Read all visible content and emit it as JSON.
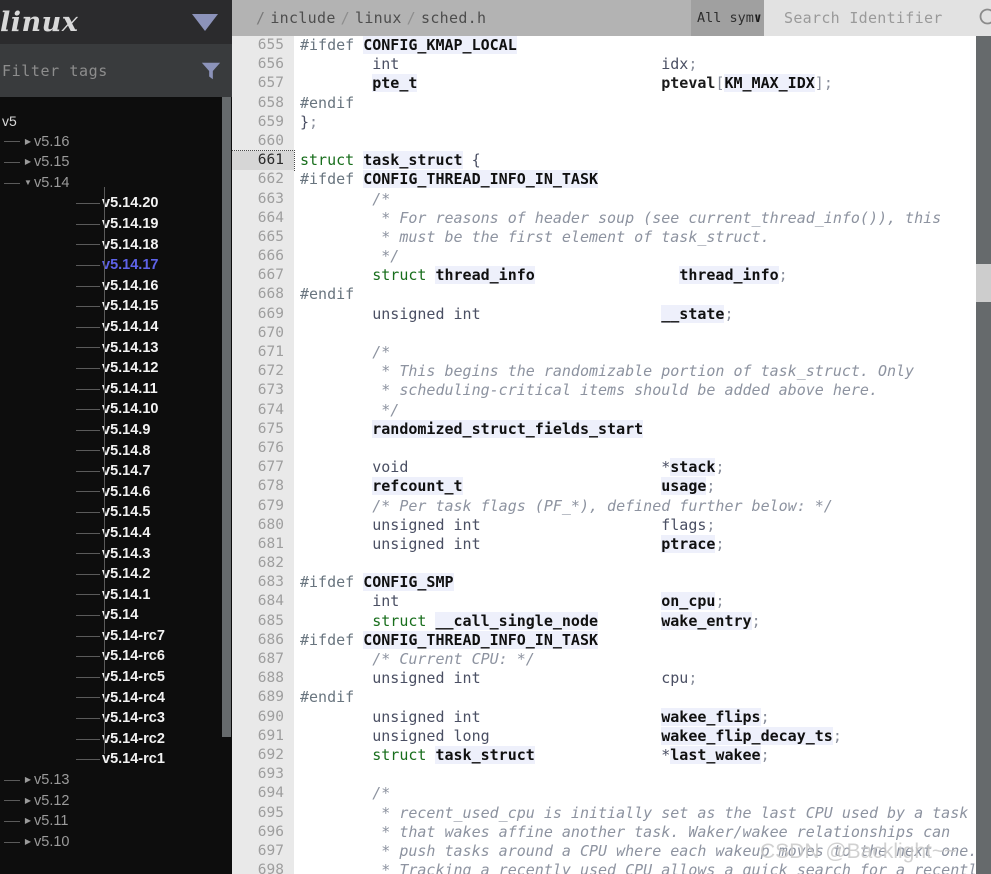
{
  "sidebar": {
    "project_title": "linux",
    "project_dropdown_icon": "chevron-down-icon",
    "filter": {
      "placeholder": "Filter tags",
      "value": "",
      "icon": "funnel-icon"
    },
    "active_tag": "v5.14.17",
    "tree": [
      {
        "label": "v5",
        "level": 0,
        "caret": ""
      },
      {
        "label": "v5.16",
        "level": 1,
        "caret": "▶"
      },
      {
        "label": "v5.15",
        "level": 1,
        "caret": "▶"
      },
      {
        "label": "v5.14",
        "level": 1,
        "caret": "▼"
      },
      {
        "label": "v5.14.20",
        "level": 2,
        "caret": ""
      },
      {
        "label": "v5.14.19",
        "level": 2,
        "caret": ""
      },
      {
        "label": "v5.14.18",
        "level": 2,
        "caret": ""
      },
      {
        "label": "v5.14.17",
        "level": 2,
        "caret": "",
        "active": true
      },
      {
        "label": "v5.14.16",
        "level": 2,
        "caret": ""
      },
      {
        "label": "v5.14.15",
        "level": 2,
        "caret": ""
      },
      {
        "label": "v5.14.14",
        "level": 2,
        "caret": ""
      },
      {
        "label": "v5.14.13",
        "level": 2,
        "caret": ""
      },
      {
        "label": "v5.14.12",
        "level": 2,
        "caret": ""
      },
      {
        "label": "v5.14.11",
        "level": 2,
        "caret": ""
      },
      {
        "label": "v5.14.10",
        "level": 2,
        "caret": ""
      },
      {
        "label": "v5.14.9",
        "level": 2,
        "caret": ""
      },
      {
        "label": "v5.14.8",
        "level": 2,
        "caret": ""
      },
      {
        "label": "v5.14.7",
        "level": 2,
        "caret": ""
      },
      {
        "label": "v5.14.6",
        "level": 2,
        "caret": ""
      },
      {
        "label": "v5.14.5",
        "level": 2,
        "caret": ""
      },
      {
        "label": "v5.14.4",
        "level": 2,
        "caret": ""
      },
      {
        "label": "v5.14.3",
        "level": 2,
        "caret": ""
      },
      {
        "label": "v5.14.2",
        "level": 2,
        "caret": ""
      },
      {
        "label": "v5.14.1",
        "level": 2,
        "caret": ""
      },
      {
        "label": "v5.14",
        "level": 2,
        "caret": ""
      },
      {
        "label": "v5.14-rc7",
        "level": 2,
        "caret": ""
      },
      {
        "label": "v5.14-rc6",
        "level": 2,
        "caret": ""
      },
      {
        "label": "v5.14-rc5",
        "level": 2,
        "caret": ""
      },
      {
        "label": "v5.14-rc4",
        "level": 2,
        "caret": ""
      },
      {
        "label": "v5.14-rc3",
        "level": 2,
        "caret": ""
      },
      {
        "label": "v5.14-rc2",
        "level": 2,
        "caret": ""
      },
      {
        "label": "v5.14-rc1",
        "level": 2,
        "caret": ""
      },
      {
        "label": "v5.13",
        "level": 1,
        "caret": "▶"
      },
      {
        "label": "v5.12",
        "level": 1,
        "caret": "▶"
      },
      {
        "label": "v5.11",
        "level": 1,
        "caret": "▶"
      },
      {
        "label": "v5.10",
        "level": 1,
        "caret": "▶"
      }
    ]
  },
  "topbar": {
    "breadcrumb": [
      "include",
      "linux",
      "sched.h"
    ],
    "breadcrumb_root": "/",
    "breadcrumb_separator": "/",
    "symbol_filter": {
      "label": "All sym",
      "icon": "chevron-down-icon"
    },
    "search": {
      "placeholder": "Search Identifier",
      "value": "",
      "icon": "search-icon"
    }
  },
  "editor": {
    "first_line": 655,
    "current_line": 661,
    "lines": [
      {
        "n": 655,
        "tokens": [
          {
            "t": "#ifdef ",
            "c": "t-pp"
          },
          {
            "t": "CONFIG_KMAP_LOCAL",
            "c": "t-macro"
          }
        ]
      },
      {
        "n": 656,
        "tokens": [
          {
            "t": "        int",
            "c": "t-plain"
          },
          {
            "t": "                             ",
            "c": "t-plain"
          },
          {
            "t": "idx",
            "c": "t-plain"
          },
          {
            "t": ";",
            "c": "t-punc"
          }
        ]
      },
      {
        "n": 657,
        "tokens": [
          {
            "t": "        ",
            "c": "t-plain"
          },
          {
            "t": "pte_t",
            "c": "t-id"
          },
          {
            "t": "                           ",
            "c": "t-plain"
          },
          {
            "t": "pteval",
            "c": "t-idp"
          },
          {
            "t": "[",
            "c": "t-punc"
          },
          {
            "t": "KM_MAX_IDX",
            "c": "t-macro"
          },
          {
            "t": "]",
            "c": "t-punc"
          },
          {
            "t": ";",
            "c": "t-punc"
          }
        ]
      },
      {
        "n": 658,
        "tokens": [
          {
            "t": "#endif",
            "c": "t-pp"
          }
        ]
      },
      {
        "n": 659,
        "tokens": [
          {
            "t": "}",
            "c": "t-plain"
          },
          {
            "t": ";",
            "c": "t-punc"
          }
        ]
      },
      {
        "n": 660,
        "tokens": []
      },
      {
        "n": 661,
        "tokens": [
          {
            "t": "struct ",
            "c": "t-kw"
          },
          {
            "t": "task_struct",
            "c": "t-id"
          },
          {
            "t": " {",
            "c": "t-plain"
          }
        ],
        "current": true
      },
      {
        "n": 662,
        "tokens": [
          {
            "t": "#ifdef ",
            "c": "t-pp"
          },
          {
            "t": "CONFIG_THREAD_INFO_IN_TASK",
            "c": "t-macro"
          }
        ]
      },
      {
        "n": 663,
        "tokens": [
          {
            "t": "        /*",
            "c": "t-cmt"
          }
        ]
      },
      {
        "n": 664,
        "tokens": [
          {
            "t": "         * For reasons of header soup (see current_thread_info()), this",
            "c": "t-cmt"
          }
        ]
      },
      {
        "n": 665,
        "tokens": [
          {
            "t": "         * must be the first element of task_struct.",
            "c": "t-cmt"
          }
        ]
      },
      {
        "n": 666,
        "tokens": [
          {
            "t": "         */",
            "c": "t-cmt"
          }
        ]
      },
      {
        "n": 667,
        "tokens": [
          {
            "t": "        struct ",
            "c": "t-kw"
          },
          {
            "t": "thread_info",
            "c": "t-id"
          },
          {
            "t": "                ",
            "c": "t-plain"
          },
          {
            "t": "thread_info",
            "c": "t-id"
          },
          {
            "t": ";",
            "c": "t-punc"
          }
        ]
      },
      {
        "n": 668,
        "tokens": [
          {
            "t": "#endif",
            "c": "t-pp"
          }
        ]
      },
      {
        "n": 669,
        "tokens": [
          {
            "t": "        unsigned int",
            "c": "t-plain"
          },
          {
            "t": "                    ",
            "c": "t-plain"
          },
          {
            "t": "__state",
            "c": "t-id"
          },
          {
            "t": ";",
            "c": "t-punc"
          }
        ]
      },
      {
        "n": 670,
        "tokens": []
      },
      {
        "n": 671,
        "tokens": [
          {
            "t": "        /*",
            "c": "t-cmt"
          }
        ]
      },
      {
        "n": 672,
        "tokens": [
          {
            "t": "         * This begins the randomizable portion of task_struct. Only",
            "c": "t-cmt"
          }
        ]
      },
      {
        "n": 673,
        "tokens": [
          {
            "t": "         * scheduling-critical items should be added above here.",
            "c": "t-cmt"
          }
        ]
      },
      {
        "n": 674,
        "tokens": [
          {
            "t": "         */",
            "c": "t-cmt"
          }
        ]
      },
      {
        "n": 675,
        "tokens": [
          {
            "t": "        ",
            "c": "t-plain"
          },
          {
            "t": "randomized_struct_fields_start",
            "c": "t-id"
          }
        ]
      },
      {
        "n": 676,
        "tokens": []
      },
      {
        "n": 677,
        "tokens": [
          {
            "t": "        void",
            "c": "t-plain"
          },
          {
            "t": "                            ",
            "c": "t-plain"
          },
          {
            "t": "*",
            "c": "t-plain"
          },
          {
            "t": "stack",
            "c": "t-id"
          },
          {
            "t": ";",
            "c": "t-punc"
          }
        ]
      },
      {
        "n": 678,
        "tokens": [
          {
            "t": "        ",
            "c": "t-plain"
          },
          {
            "t": "refcount_t",
            "c": "t-id"
          },
          {
            "t": "                      ",
            "c": "t-plain"
          },
          {
            "t": "usage",
            "c": "t-id"
          },
          {
            "t": ";",
            "c": "t-punc"
          }
        ]
      },
      {
        "n": 679,
        "tokens": [
          {
            "t": "        /* Per task flags (PF_*), defined further below: */",
            "c": "t-cmt"
          }
        ]
      },
      {
        "n": 680,
        "tokens": [
          {
            "t": "        unsigned int",
            "c": "t-plain"
          },
          {
            "t": "                    ",
            "c": "t-plain"
          },
          {
            "t": "flags",
            "c": "t-plain"
          },
          {
            "t": ";",
            "c": "t-punc"
          }
        ]
      },
      {
        "n": 681,
        "tokens": [
          {
            "t": "        unsigned int",
            "c": "t-plain"
          },
          {
            "t": "                    ",
            "c": "t-plain"
          },
          {
            "t": "ptrace",
            "c": "t-id"
          },
          {
            "t": ";",
            "c": "t-punc"
          }
        ]
      },
      {
        "n": 682,
        "tokens": []
      },
      {
        "n": 683,
        "tokens": [
          {
            "t": "#ifdef ",
            "c": "t-pp"
          },
          {
            "t": "CONFIG_SMP",
            "c": "t-macro"
          }
        ]
      },
      {
        "n": 684,
        "tokens": [
          {
            "t": "        int",
            "c": "t-plain"
          },
          {
            "t": "                             ",
            "c": "t-plain"
          },
          {
            "t": "on_cpu",
            "c": "t-id"
          },
          {
            "t": ";",
            "c": "t-punc"
          }
        ]
      },
      {
        "n": 685,
        "tokens": [
          {
            "t": "        struct ",
            "c": "t-kw"
          },
          {
            "t": "__call_single_node",
            "c": "t-id"
          },
          {
            "t": "       ",
            "c": "t-plain"
          },
          {
            "t": "wake_entry",
            "c": "t-id"
          },
          {
            "t": ";",
            "c": "t-punc"
          }
        ]
      },
      {
        "n": 686,
        "tokens": [
          {
            "t": "#ifdef ",
            "c": "t-pp"
          },
          {
            "t": "CONFIG_THREAD_INFO_IN_TASK",
            "c": "t-macro"
          }
        ]
      },
      {
        "n": 687,
        "tokens": [
          {
            "t": "        /* Current CPU: */",
            "c": "t-cmt"
          }
        ]
      },
      {
        "n": 688,
        "tokens": [
          {
            "t": "        unsigned int",
            "c": "t-plain"
          },
          {
            "t": "                    ",
            "c": "t-plain"
          },
          {
            "t": "cpu",
            "c": "t-plain"
          },
          {
            "t": ";",
            "c": "t-punc"
          }
        ]
      },
      {
        "n": 689,
        "tokens": [
          {
            "t": "#endif",
            "c": "t-pp"
          }
        ]
      },
      {
        "n": 690,
        "tokens": [
          {
            "t": "        unsigned int",
            "c": "t-plain"
          },
          {
            "t": "                    ",
            "c": "t-plain"
          },
          {
            "t": "wakee_flips",
            "c": "t-id"
          },
          {
            "t": ";",
            "c": "t-punc"
          }
        ]
      },
      {
        "n": 691,
        "tokens": [
          {
            "t": "        unsigned long",
            "c": "t-plain"
          },
          {
            "t": "                   ",
            "c": "t-plain"
          },
          {
            "t": "wakee_flip_decay_ts",
            "c": "t-id"
          },
          {
            "t": ";",
            "c": "t-punc"
          }
        ]
      },
      {
        "n": 692,
        "tokens": [
          {
            "t": "        struct ",
            "c": "t-kw"
          },
          {
            "t": "task_struct",
            "c": "t-id"
          },
          {
            "t": "              ",
            "c": "t-plain"
          },
          {
            "t": "*",
            "c": "t-plain"
          },
          {
            "t": "last_wakee",
            "c": "t-id"
          },
          {
            "t": ";",
            "c": "t-punc"
          }
        ]
      },
      {
        "n": 693,
        "tokens": []
      },
      {
        "n": 694,
        "tokens": [
          {
            "t": "        /*",
            "c": "t-cmt"
          }
        ]
      },
      {
        "n": 695,
        "tokens": [
          {
            "t": "         * recent_used_cpu is initially set as the last CPU used by a task",
            "c": "t-cmt"
          }
        ]
      },
      {
        "n": 696,
        "tokens": [
          {
            "t": "         * that wakes affine another task. Waker/wakee relationships can",
            "c": "t-cmt"
          }
        ]
      },
      {
        "n": 697,
        "tokens": [
          {
            "t": "         * push tasks around a CPU where each wakeup moves to the next one.",
            "c": "t-cmt"
          }
        ]
      },
      {
        "n": 698,
        "tokens": [
          {
            "t": "         * Tracking a recently used CPU allows a quick search for a recently",
            "c": "t-cmt"
          }
        ]
      }
    ]
  },
  "watermark": {
    "text": "CSDN @Backlight~~"
  },
  "colors": {
    "sidebar_bg": "#0d0d0d",
    "sidebar_header_bg": "#2b2b2d",
    "sidebar_filter_bg": "#393b3d",
    "accent_active_tag": "#5e63e8",
    "caret_purple": "#8c93ba",
    "breadcrumb_bg": "#b3b3b3",
    "symbol_select_bg": "#a0a0a0",
    "search_bg": "#e2e2e2",
    "gutter_bg": "#e9e9e9",
    "current_line_bg": "#d6d6d6",
    "identifier_bg": "#eef0fb",
    "keyword_green": "#186e1c",
    "comment_gray": "#8d93a0",
    "scrollbar_track": "#666a6c",
    "scrollbar_thumb": "#cdcdcd"
  }
}
